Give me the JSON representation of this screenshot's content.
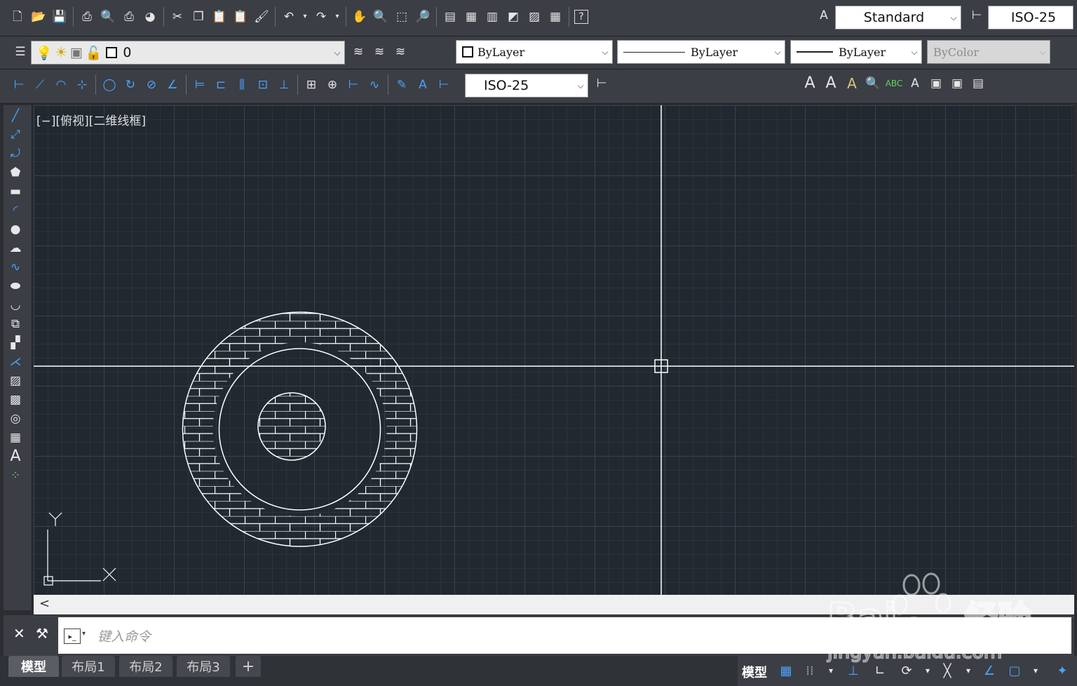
{
  "toolbar": {
    "standard_icons": [
      "new-icon",
      "open-icon",
      "save-icon",
      "plot-icon",
      "plot-preview-icon",
      "publish-icon",
      "render-icon",
      "cut-icon",
      "copy-icon",
      "paste-icon",
      "paste-special-icon",
      "match-properties-icon",
      "undo-icon",
      "redo-icon",
      "pan-icon",
      "zoom-realtime-icon",
      "zoom-window-icon",
      "zoom-previous-icon",
      "properties-icon",
      "design-center-icon",
      "tool-palettes-icon",
      "sheet-set-icon",
      "markup-icon",
      "calculator-icon",
      "help-icon"
    ],
    "text_style": "Standard",
    "dim_style_top": "ISO-25",
    "layer_name": "0",
    "color": "ByLayer",
    "linetype": "ByLayer",
    "lineweight": "ByLayer",
    "plot_style": "ByColor",
    "dim_style": "ISO-25",
    "text_tools": [
      "A",
      "A",
      "A"
    ]
  },
  "viewport": {
    "label": "[−][俯视][二维线框]",
    "ucs_x": "X",
    "ucs_y": "Y",
    "colors": {
      "background": "#212830",
      "lines": "#ffffff"
    }
  },
  "command_line": {
    "placeholder": "键入命令",
    "close_glyph": "✕",
    "settings_glyph": "🔧",
    "prompt_glyph": "▸_"
  },
  "layout_tabs": [
    {
      "label": "模型",
      "active": true
    },
    {
      "label": "布局1",
      "active": false
    },
    {
      "label": "布局2",
      "active": false
    },
    {
      "label": "布局3",
      "active": false
    }
  ],
  "add_tab": "+",
  "status": {
    "model_button": "模型"
  },
  "scroll_arrow": "<"
}
